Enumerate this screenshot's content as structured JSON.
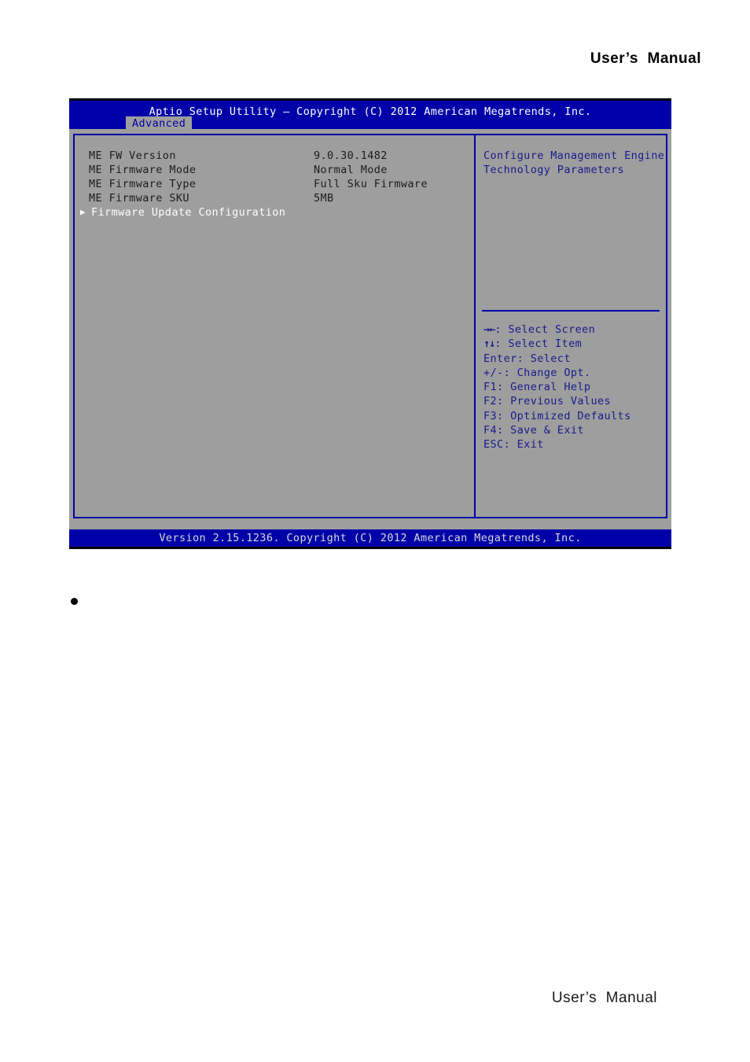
{
  "page": {
    "header_title": "User’s  Manual",
    "footer_title": "User’s  Manual",
    "bullet_text": ""
  },
  "bios": {
    "title": "Aptio Setup Utility – Copyright (C) 2012 American Megatrends, Inc.",
    "active_tab": "Advanced",
    "status_bar": "Version 2.15.1236. Copyright (C) 2012 American Megatrends, Inc.",
    "settings": [
      {
        "label": "ME FW Version",
        "value": "9.0.30.1482"
      },
      {
        "label": "ME Firmware Mode",
        "value": "Normal Mode"
      },
      {
        "label": "ME Firmware Type",
        "value": "Full Sku Firmware"
      },
      {
        "label": "ME Firmware SKU",
        "value": "5MB"
      }
    ],
    "submenu": {
      "arrow": "▶",
      "label": "Firmware Update Configuration"
    },
    "help": {
      "line1": "Configure Management Engine",
      "line2": "Technology Parameters"
    },
    "legend": [
      {
        "sym": "→←",
        "text": ": Select Screen"
      },
      {
        "sym": "↑↓",
        "text": ": Select Item"
      },
      {
        "sym": "Enter",
        "text": ": Select"
      },
      {
        "sym": "+/-",
        "text": ": Change Opt."
      },
      {
        "sym": "F1",
        "text": ": General Help"
      },
      {
        "sym": "F2",
        "text": ": Previous Values"
      },
      {
        "sym": "F3",
        "text": ": Optimized Defaults"
      },
      {
        "sym": "F4",
        "text": ": Save & Exit"
      },
      {
        "sym": "ESC",
        "text": ": Exit"
      }
    ]
  },
  "colors": {
    "bios_blue": "#0000a8",
    "bios_gray": "#9e9e9e",
    "help_text": "#1a1a8c",
    "label_text": "#1c1c1c",
    "selected_text": "#ffffff"
  }
}
